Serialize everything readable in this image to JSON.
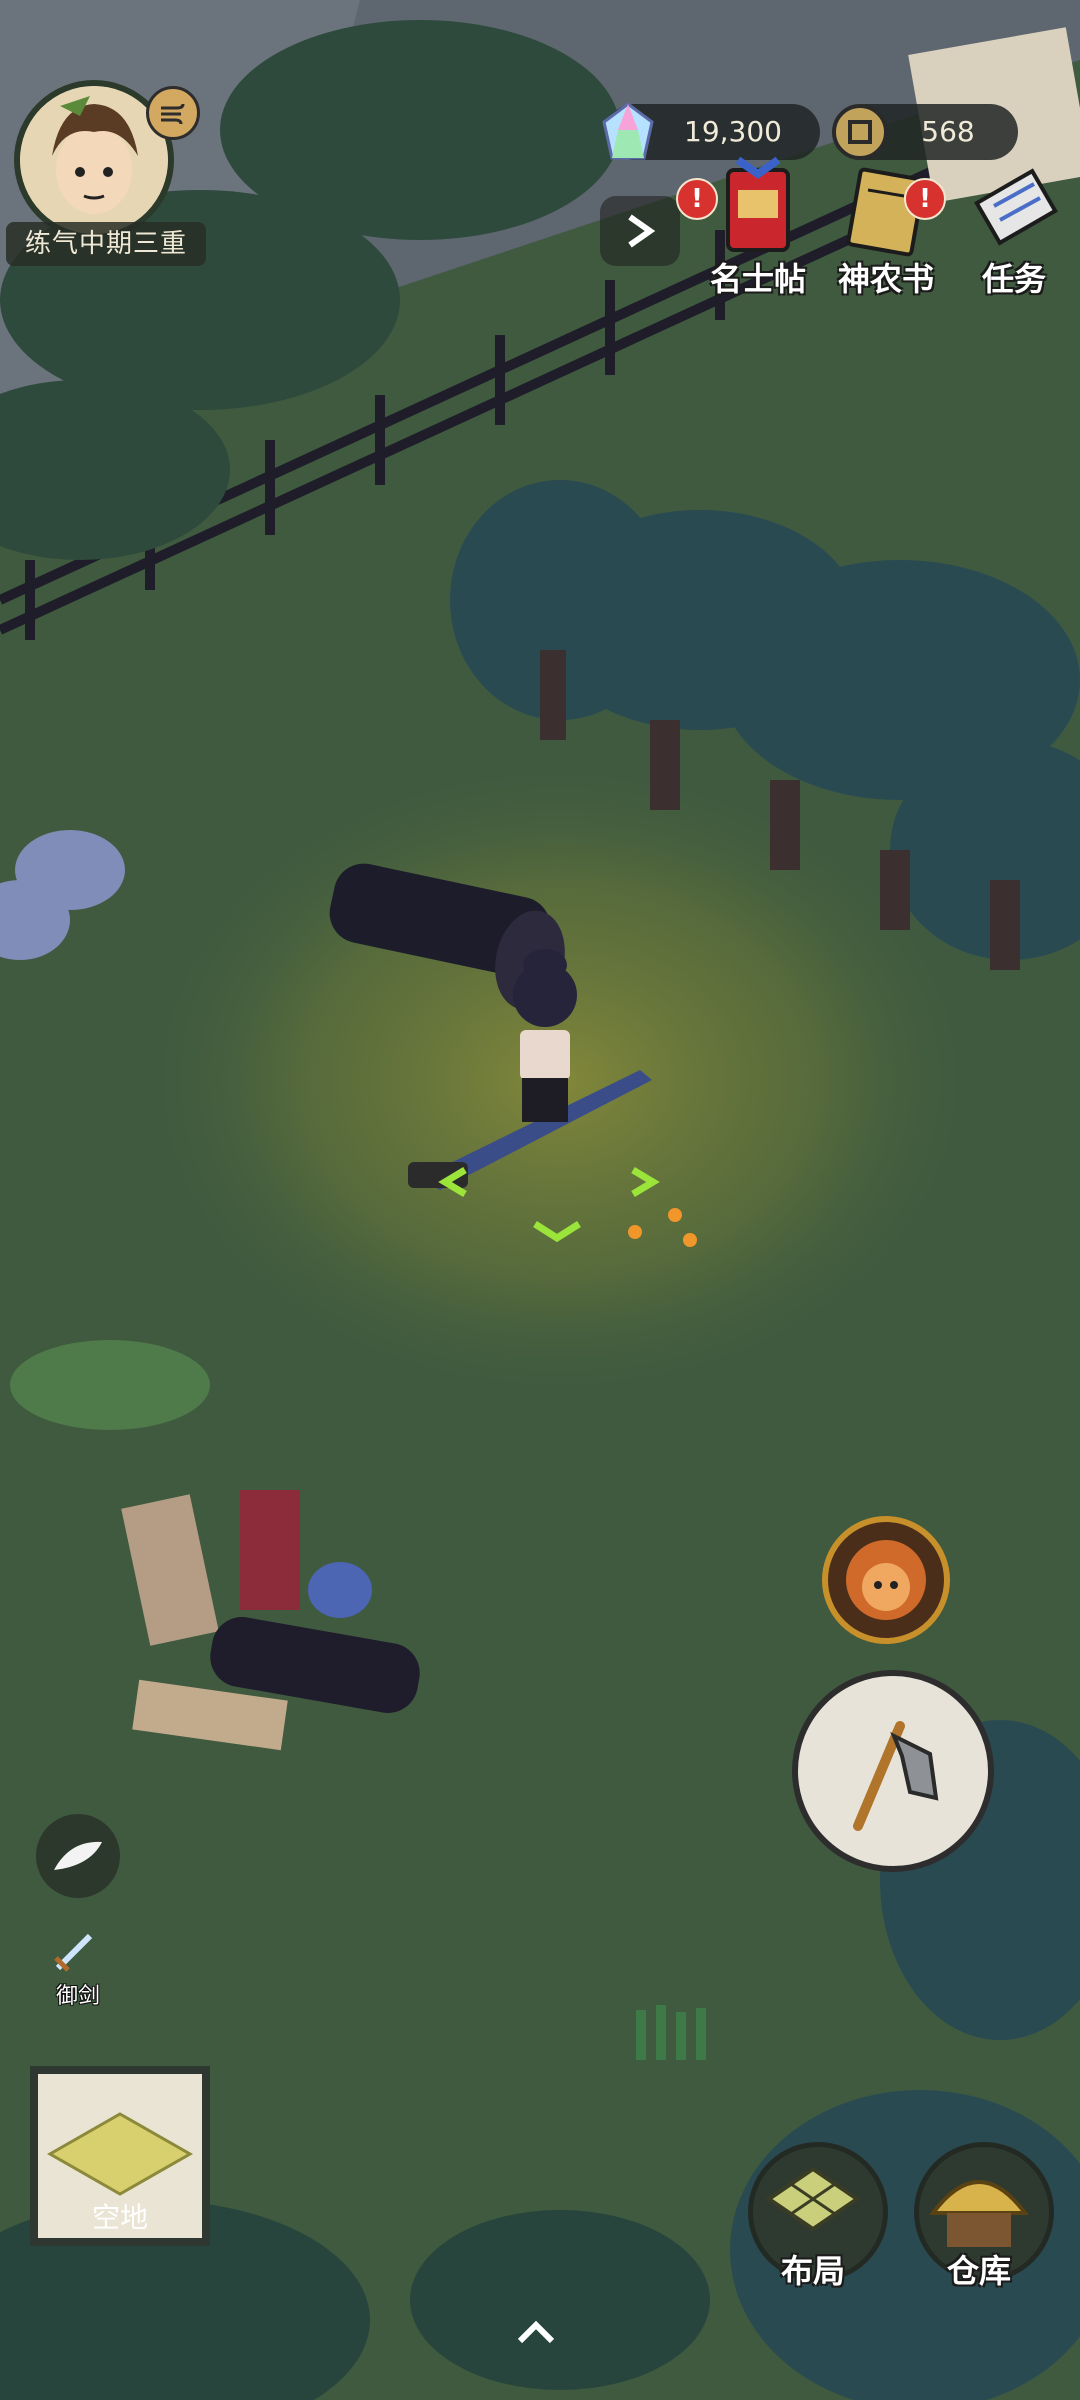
{
  "player": {
    "level_title": "练气中期三重"
  },
  "currencies": {
    "spirit_stones": "19,300",
    "coins": "568"
  },
  "top_menu": {
    "items": [
      {
        "label": "名士帖",
        "has_alert": true,
        "alert": "!"
      },
      {
        "label": "神农书",
        "has_alert": true,
        "alert": "!"
      },
      {
        "label": "任务",
        "has_alert": false
      }
    ]
  },
  "side_actions": {
    "sword_label": "御剑"
  },
  "tile_selector": {
    "label": "空地"
  },
  "bottom_menu": {
    "layout_label": "布局",
    "storage_label": "仓库"
  },
  "colors": {
    "grass": "#3f5a3f",
    "grass_light": "#6c7a3a",
    "sky": "#5d6670",
    "fence": "#1f1d2a",
    "alert_red": "#d8322f",
    "highlight_green": "#9be53a"
  }
}
